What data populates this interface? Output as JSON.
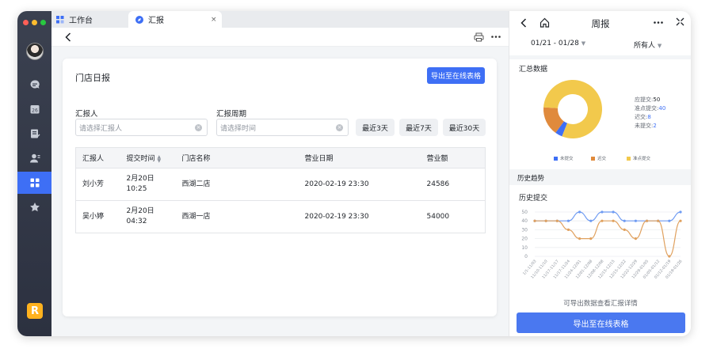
{
  "window": {
    "tabs": [
      {
        "label": "工作台",
        "icon": "grid-icon"
      },
      {
        "label": "汇报",
        "icon": "report-icon"
      }
    ],
    "close_glyph": "×",
    "traffic_colors": [
      "#ff5f57",
      "#febc2e",
      "#28c840"
    ]
  },
  "rail": {
    "items": [
      "chat-icon",
      "calendar-icon",
      "doc-icon",
      "contacts-icon",
      "workspace-icon",
      "star-icon"
    ],
    "active": "workspace-icon",
    "calendar_day": "26",
    "logo_letter": "R"
  },
  "main": {
    "title": "门店日报",
    "export_label": "导出至在线表格",
    "reporter_label": "汇报人",
    "reporter_placeholder": "请选择汇报人",
    "period_label": "汇报周期",
    "period_placeholder": "请选择时间",
    "quick_ranges": [
      "最近3天",
      "最近7天",
      "最近30天"
    ],
    "table": {
      "columns": [
        "汇报人",
        "提交时间",
        "门店名称",
        "营业日期",
        "营业额"
      ],
      "rows": [
        {
          "reporter": "刘小芳",
          "submit_date": "2月20日",
          "submit_time": "10:25",
          "store": "西湖二店",
          "business_date": "2020-02-19 23:30",
          "revenue": "24586"
        },
        {
          "reporter": "吴小婷",
          "submit_date": "2月20日",
          "submit_time": "04:32",
          "store": "西湖一店",
          "business_date": "2020-02-19 23:30",
          "revenue": "54000"
        }
      ]
    }
  },
  "panel": {
    "title": "周报",
    "date_range": "01/21 - 01/28",
    "owner_filter": "所有人",
    "summary_title": "汇总数据",
    "stats": [
      {
        "label": "应提交:",
        "value": "50"
      },
      {
        "label": "准点提交:",
        "value": "40"
      },
      {
        "label": "迟交:",
        "value": "8"
      },
      {
        "label": "未提交:",
        "value": "2"
      }
    ],
    "history_section": "历史趋势",
    "history_title": "历史提交",
    "foot_note": "可导出数据查看汇报详情",
    "export_label": "导出至在线表格"
  },
  "chart_data": [
    {
      "type": "pie",
      "title": "汇总数据",
      "categories": [
        "未提交",
        "迟交",
        "准点提交"
      ],
      "values": [
        2,
        8,
        40
      ],
      "colors": [
        "#3e6ff5",
        "#e08a3c",
        "#f2c94c"
      ],
      "legend": "bottom"
    },
    {
      "type": "line",
      "title": "历史提交",
      "x": [
        "1/1-11/03",
        "11/10-11/10",
        "11/17-11/17",
        "11/17-11/24",
        "11/24-12/01",
        "12/01-12/08",
        "12/08-12/08",
        "12/15-12/15",
        "12/15-12/22",
        "12/22-12/29",
        "12/29-01/05",
        "01/05-01/12",
        "01/12-01/19",
        "01/19-01/26"
      ],
      "yticks": [
        0,
        10,
        20,
        30,
        40,
        50
      ],
      "ylim": [
        0,
        50
      ],
      "grid": true,
      "series": [
        {
          "values": [
            40,
            40,
            40,
            40,
            50,
            40,
            50,
            50,
            40,
            40,
            40,
            40,
            40,
            50
          ],
          "color": "#6f9bf2"
        },
        {
          "values": [
            40,
            40,
            40,
            30,
            20,
            20,
            40,
            40,
            30,
            20,
            40,
            40,
            0,
            40
          ],
          "color": "#e0a15f"
        }
      ]
    }
  ]
}
